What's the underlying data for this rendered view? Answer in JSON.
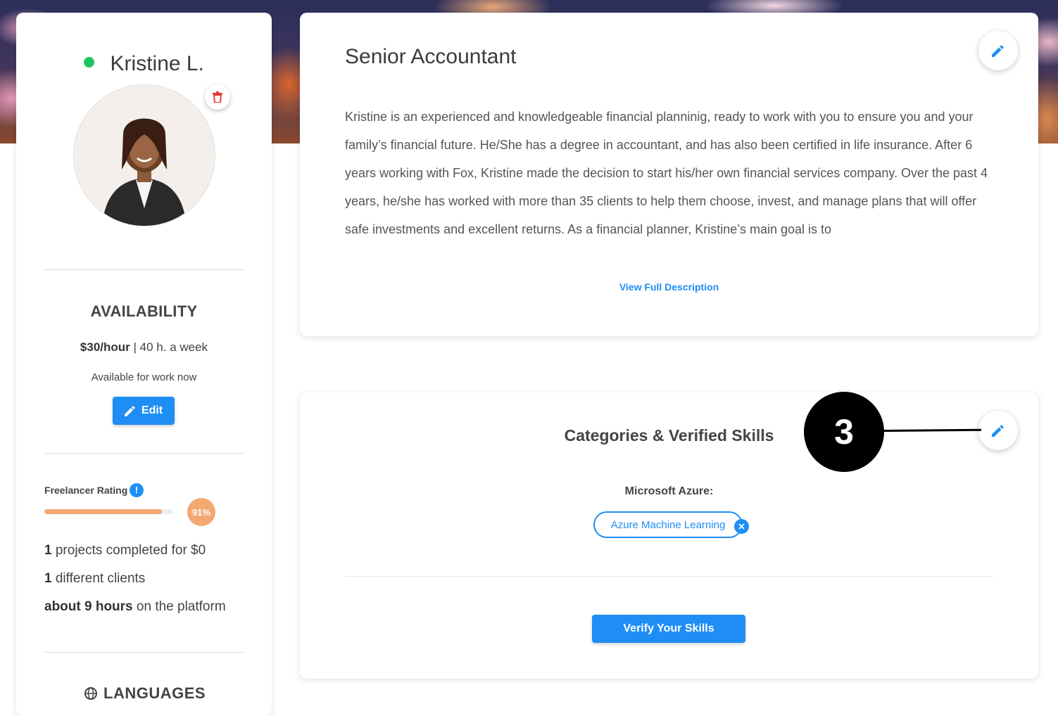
{
  "profile": {
    "name": "Kristine L.",
    "status": "online",
    "availability_title": "AVAILABILITY",
    "rate": "$30/hour",
    "rate_separator": " | ",
    "hours": "40 h. a week",
    "available_text": "Available for work now",
    "edit_label": "Edit",
    "rating_label": "Freelancer Rating",
    "rating_percent_text": "91%",
    "rating_value": 0.91,
    "stats": [
      {
        "strong": "1",
        "text": " projects completed for $0"
      },
      {
        "strong": "1",
        "text": " different clients"
      },
      {
        "strong": "about 9 hours",
        "text": " on the platform"
      }
    ],
    "languages_title": "LANGUAGES"
  },
  "about": {
    "title": "Senior Accountant",
    "description": "Kristine is an experienced and knowledgeable financial planninig, ready to work with you to ensure you and your family’s financial future. He/She has a degree in accountant, and has also been certified in life insurance. After 6 years working with Fox, Kristine made the decision to start his/her own financial services company. Over the past 4 years, he/she has worked with more than 35 clients to help them choose, invest, and manage plans that will offer safe investments and excellent returns. As a financial planner, Kristine’s main goal is to",
    "view_full_label": "View Full Description"
  },
  "skills": {
    "title": "Categories & Verified Skills",
    "group_label": "Microsoft Azure:",
    "chips": [
      "Azure Machine Learning"
    ],
    "verify_label": "Verify Your Skills"
  },
  "annotation": {
    "number": "3"
  },
  "colors": {
    "accent": "#1e8ef5",
    "online": "#1fc465",
    "rating": "#f3a872",
    "danger": "#e53935"
  },
  "icons": [
    "status-dot",
    "trash-icon",
    "pencil-icon",
    "info-icon",
    "close-icon",
    "globe-icon"
  ]
}
